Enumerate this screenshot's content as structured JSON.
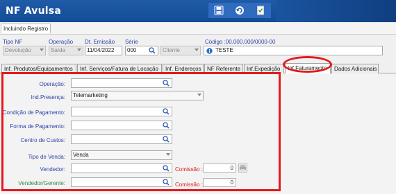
{
  "window": {
    "title": "NF Avulsa"
  },
  "toolbar": {
    "icons": [
      "save-icon",
      "refresh-icon",
      "document-check-icon"
    ]
  },
  "status": {
    "mode": "Incluindo Registro"
  },
  "header": {
    "tipo_nf_label": "Tipo NF",
    "tipo_nf_value": "Devolução",
    "operacao_label": "Operação",
    "operacao_value": "Saída",
    "dt_emissao_label": "Dt. Emissão",
    "dt_emissao_value": "11/04/2022",
    "serie_label": "Série",
    "serie_value": "000",
    "destino_value": "Cliente",
    "codigo_label": "Código :00.000.000/0000-00",
    "codigo_value": "TESTE"
  },
  "tabs": [
    {
      "label": "Inf. Produtos/Equipamentos"
    },
    {
      "label": "Inf. Serviços/Fatura de Locação"
    },
    {
      "label": "Inf. Endereços"
    },
    {
      "label": "NF Referente"
    },
    {
      "label": "Inf.Expedição"
    },
    {
      "label": "Inf.Faturamento"
    },
    {
      "label": "Dados Adicionais"
    }
  ],
  "form": {
    "operacao_label": "Operação:",
    "ind_presenca_label": "Ind.Presença:",
    "ind_presenca_value": "Telemarketing",
    "condicao_label": "Condição de Pagamento:",
    "forma_label": "Forma de Pagamento:",
    "centro_label": "Centro de Custos:",
    "tipo_venda_label": "Tipo de Venda:",
    "tipo_venda_value": "Venda",
    "vendedor_label": "Vendedor:",
    "vendedor_gerente_label": "Vendedor/Gerente:",
    "comissao_label": "Comissão :",
    "comissao_vendedor_value": "0",
    "comissao_gerente_value": "0"
  },
  "colors": {
    "highlight": "#e3191e",
    "label_blue": "#2d43a8",
    "title_bar": "#1f5ba8"
  }
}
